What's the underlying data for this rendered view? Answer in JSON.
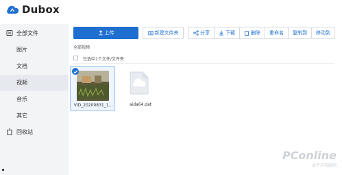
{
  "app": {
    "name": "Dubox"
  },
  "sidebar": {
    "items": [
      {
        "label": "全部文件",
        "icon": "folder-icon"
      },
      {
        "label": "图片"
      },
      {
        "label": "文档"
      },
      {
        "label": "视频",
        "active": true
      },
      {
        "label": "音乐"
      },
      {
        "label": "其它"
      },
      {
        "label": "回收站",
        "icon": "trash-icon"
      }
    ]
  },
  "toolbar": {
    "upload_label": "上传",
    "new_folder_label": "新建文件夹",
    "share_label": "分享",
    "download_label": "下载",
    "delete_label": "删除",
    "rename_label": "重命名",
    "copy_to_label": "复制到",
    "move_to_label": "移动到"
  },
  "breadcrumb": {
    "label": "全部视频"
  },
  "selection": {
    "text": "已选中1个文件/文件夹"
  },
  "files": [
    {
      "name": "VID_20200831_1...",
      "selected": true,
      "type": "video-thumbnail"
    },
    {
      "name": "aida64.dat",
      "selected": false,
      "type": "cloud-file-icon"
    }
  ],
  "watermark": {
    "text": "PConline",
    "subtext": "太平洋电脑网"
  },
  "colors": {
    "accent": "#1f6fd1",
    "sidebar_bg": "#f3f4f6"
  }
}
